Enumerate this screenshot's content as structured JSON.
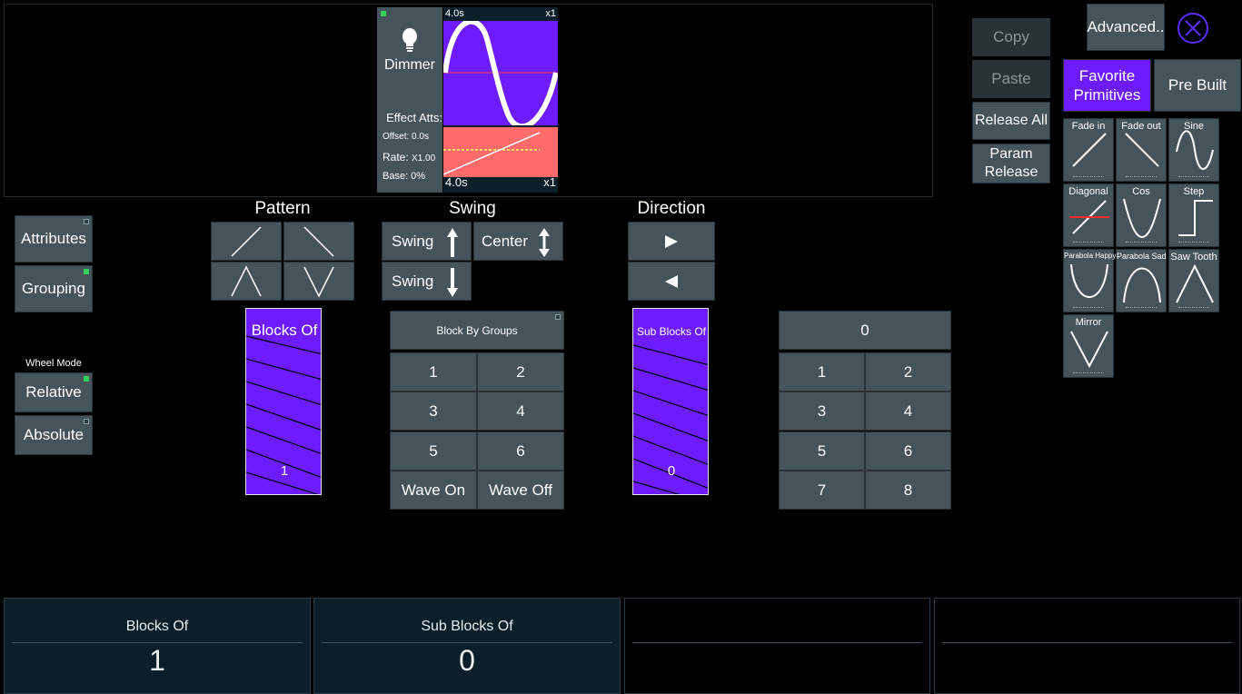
{
  "preview": {
    "attribute_name": "Dimmer",
    "time_top": "4.0s",
    "mult_top": "x1",
    "time_bottom": "4.0s",
    "mult_bottom": "x1",
    "effect_atts_label": "Effect Atts:",
    "offset_label": "Offset: 0.0s",
    "rate_label": "Rate:",
    "rate_value": "X1.00",
    "base_label": "Base: 0%"
  },
  "right_buttons": {
    "copy": "Copy",
    "paste": "Paste",
    "release_all": "Release All",
    "param_release": "Param\nRelease",
    "advanced": "Advanced.."
  },
  "tabs": {
    "favorite": "Favorite\nPrimitives",
    "prebuilt": "Pre Built"
  },
  "primitives": [
    "Fade in",
    "Fade out",
    "Sine",
    "Diagonal",
    "Cos",
    "Step",
    "Parabola Happy",
    "Parabola Sad",
    "Saw Tooth",
    "Mirror"
  ],
  "left": {
    "attributes": "Attributes",
    "grouping": "Grouping",
    "wheel_mode": "Wheel Mode",
    "relative": "Relative",
    "absolute": "Absolute"
  },
  "sections": {
    "pattern": "Pattern",
    "swing": "Swing",
    "direction": "Direction"
  },
  "swing": {
    "swing_up": "Swing",
    "center": "Center",
    "swing_down": "Swing"
  },
  "blocks_of": {
    "label": "Blocks Of",
    "value": "1"
  },
  "sub_blocks_of": {
    "label": "Sub Blocks Of",
    "value": "0"
  },
  "block_groups": {
    "header": "Block By Groups",
    "keys": [
      "1",
      "2",
      "3",
      "4",
      "5",
      "6"
    ],
    "wave_on": "Wave On",
    "wave_off": "Wave Off"
  },
  "numpad": {
    "display": "0",
    "keys": [
      "1",
      "2",
      "3",
      "4",
      "5",
      "6",
      "7",
      "8"
    ]
  },
  "bottom": [
    {
      "title": "Blocks Of",
      "value": "1"
    },
    {
      "title": "Sub Blocks Of",
      "value": "0"
    }
  ],
  "colors": {
    "accent_purple": "#6c1cff",
    "button_gray": "#45535a",
    "curve_red": "#ff6b6b",
    "led_green": "#34d05a"
  }
}
